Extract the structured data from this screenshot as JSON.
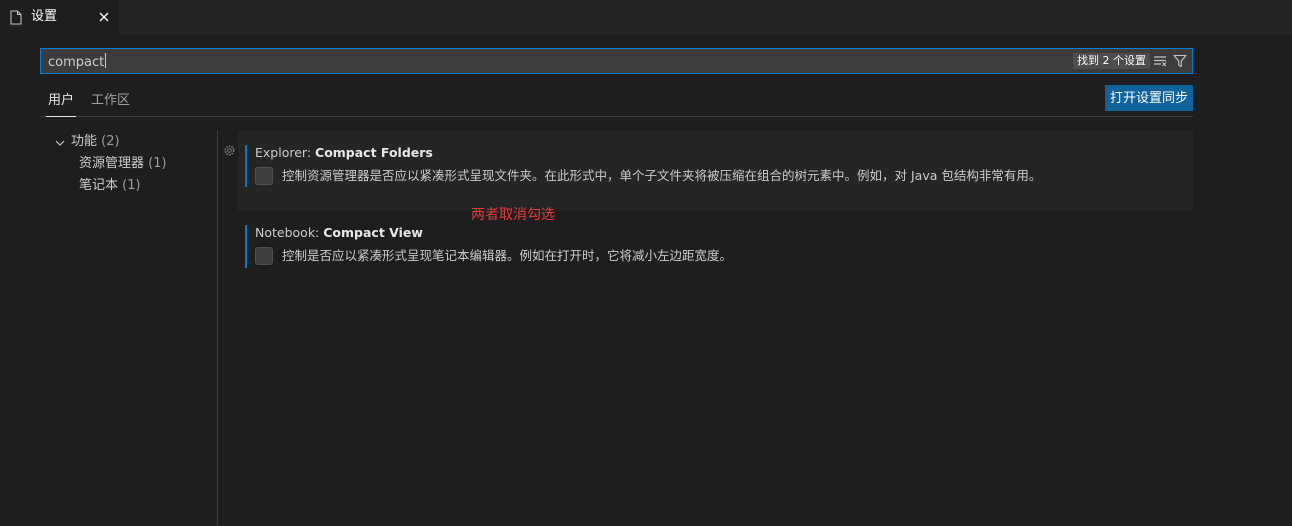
{
  "tab": {
    "label": "设置"
  },
  "search": {
    "value": "compact",
    "result_count": "找到 2 个设置"
  },
  "scopes": {
    "user": "用户",
    "workspace": "工作区"
  },
  "sync_button": "打开设置同步",
  "toc": {
    "feature": {
      "label": "功能",
      "count": "(2)"
    },
    "explorer": {
      "label": "资源管理器",
      "count": "(1)"
    },
    "notebook": {
      "label": "笔记本",
      "count": "(1)"
    }
  },
  "settings": [
    {
      "category": "Explorer: ",
      "key": "Compact Folders",
      "description": "控制资源管理器是否应以紧凑形式呈现文件夹。在此形式中，单个子文件夹将被压缩在组合的树元素中。例如，对 Java 包结构非常有用。",
      "checked": false
    },
    {
      "category": "Notebook: ",
      "key": "Compact View",
      "description": "控制是否应以紧凑形式呈现笔记本编辑器。例如在打开时，它将减小左边距宽度。",
      "checked": false
    }
  ],
  "annotation": "两者取消勾选",
  "colors": {
    "accent": "#007acc",
    "button": "#0e639c",
    "annotation": "#e03b3b"
  }
}
